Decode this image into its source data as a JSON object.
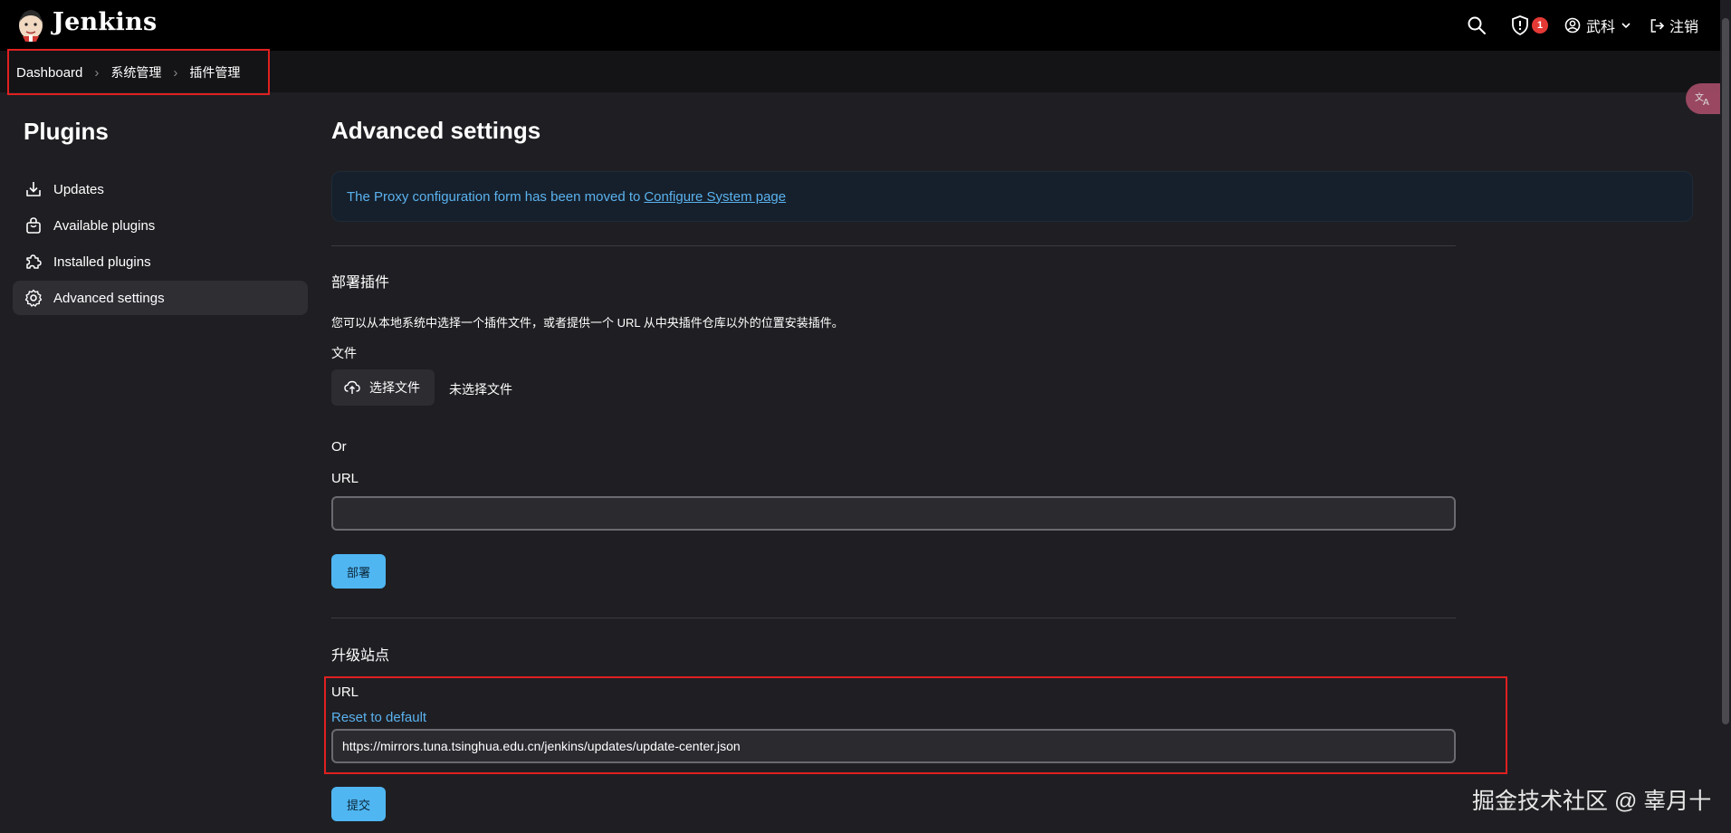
{
  "header": {
    "brand": "Jenkins",
    "security_badge_count": "1",
    "user_name": "武科",
    "logout_label": "注销"
  },
  "breadcrumb": {
    "items": [
      "Dashboard",
      "系统管理",
      "插件管理"
    ]
  },
  "sidebar": {
    "title": "Plugins",
    "items": [
      {
        "label": "Updates",
        "icon": "download-icon"
      },
      {
        "label": "Available plugins",
        "icon": "shopping-bag-icon"
      },
      {
        "label": "Installed plugins",
        "icon": "puzzle-icon"
      },
      {
        "label": "Advanced settings",
        "icon": "gear-icon",
        "active": true
      }
    ]
  },
  "main": {
    "title": "Advanced settings",
    "notice": {
      "text": "The Proxy configuration form has been moved to",
      "link": "Configure System page"
    },
    "deploy": {
      "title": "部署插件",
      "description": "您可以从本地系统中选择一个插件文件，或者提供一个 URL 从中央插件仓库以外的位置安装插件。",
      "file_label": "文件",
      "choose_file_label": "选择文件",
      "no_file_label": "未选择文件",
      "or_label": "Or",
      "url_label": "URL",
      "url_value": "",
      "submit_label": "部署"
    },
    "update_site": {
      "title": "升级站点",
      "url_label": "URL",
      "reset_label": "Reset to default",
      "url_value": "https://mirrors.tuna.tsinghua.edu.cn/jenkins/updates/update-center.json",
      "submit_label": "提交"
    }
  },
  "watermark": "掘金技术社区 @ 辜月十",
  "colors": {
    "accent": "#4fb6f2",
    "link": "#5ab2ef",
    "highlight_box": "#e02020",
    "badge": "#e53935"
  }
}
